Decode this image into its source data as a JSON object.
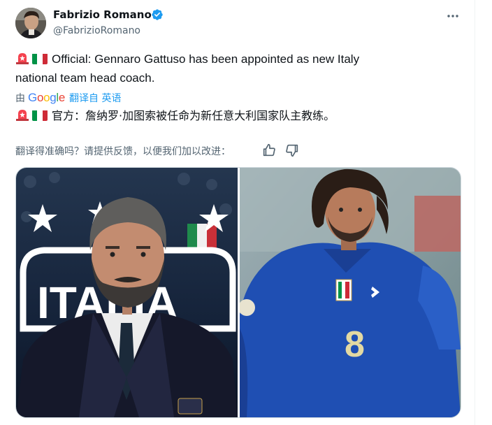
{
  "author": {
    "name": "Fabrizio Romano",
    "handle": "@FabrizioRomano"
  },
  "tweet": {
    "line1": "Official: Gennaro Gattuso has been appointed as new Italy",
    "line2": "national team head coach."
  },
  "translation": {
    "by_prefix": "由",
    "google_letters": [
      "G",
      "o",
      "o",
      "g",
      "l",
      "e"
    ],
    "google_colors": [
      "#4285f4",
      "#ea4335",
      "#fbbc05",
      "#4285f4",
      "#34a853",
      "#ea4335"
    ],
    "link_label": "翻译自 英语",
    "translated_text": "官方：詹纳罗·加图索被任命为新任意大利国家队主教练。"
  },
  "feedback": {
    "question": "翻译得准确吗？请提供反馈，以便我们加以改进："
  },
  "media": {
    "left_photo_lettering": "ITALIA",
    "right_photo_number": "8"
  },
  "colors": {
    "accent": "#1d9bf0",
    "verified": "#1d9bf0",
    "secondary_text": "#536471",
    "flag_green": "#009246",
    "flag_white": "#ffffff",
    "flag_red": "#ce2b37",
    "siren": "#f4424e"
  },
  "icons": {
    "verified": "verified-badge-icon",
    "more": "more-dots-icon",
    "siren": "siren-emoji-icon",
    "flag": "italy-flag-emoji-icon",
    "thumb_up": "thumbs-up-icon",
    "thumb_down": "thumbs-down-icon"
  }
}
